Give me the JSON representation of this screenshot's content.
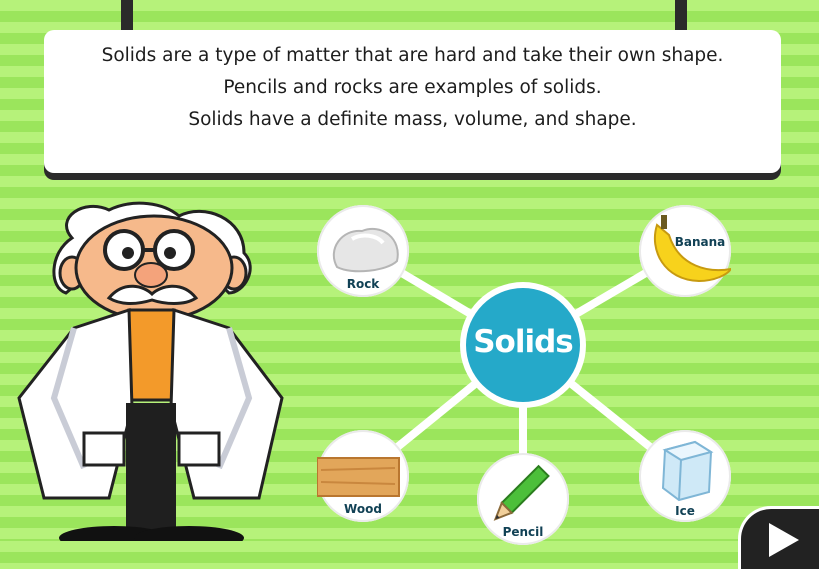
{
  "info_card": {
    "lines": [
      "Solids are a type of matter that are hard and take their own shape.",
      "Pencils and rocks are examples of solids.",
      "Solids have a definite mass, volume, and shape."
    ]
  },
  "concept_map": {
    "center_label": "Solids",
    "items": [
      {
        "label": "Rock",
        "icon": "rock-icon"
      },
      {
        "label": "Banana",
        "icon": "banana-icon"
      },
      {
        "label": "Wood",
        "icon": "wood-plank-icon"
      },
      {
        "label": "Pencil",
        "icon": "pencil-icon"
      },
      {
        "label": "Ice",
        "icon": "ice-cube-icon"
      }
    ]
  },
  "character": {
    "icon": "scientist-character"
  },
  "navigation": {
    "next_icon": "play-next-icon"
  },
  "colors": {
    "stripe_light": "#b6f27a",
    "stripe_dark": "#9be55c",
    "hub": "#25a9c9",
    "label_text": "#114155"
  }
}
